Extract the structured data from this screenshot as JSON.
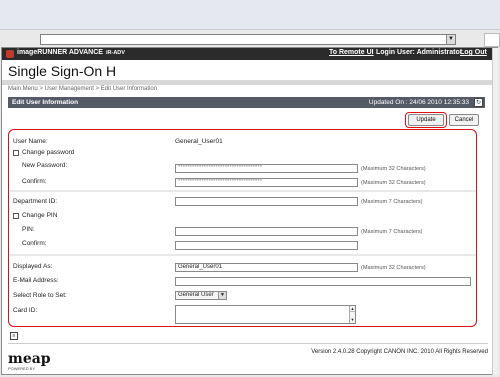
{
  "header": {
    "product": "imageRUNNER ADVANCE",
    "model": "iR-ADV",
    "link_remote_ui": "To Remote UI",
    "login_user": "Login User: Administrator",
    "logout": "Log Out"
  },
  "app_title": "Single Sign-On H",
  "breadcrumb": "Main Menu > User Management  > Edit User Information",
  "section": {
    "title": "Edit User Information",
    "updated": "Updated On : 24/06 2010 12:35:33"
  },
  "buttons": {
    "update": "Update",
    "cancel": "Cancel"
  },
  "form": {
    "user_name_label": "User Name:",
    "user_name_value": "General_User01",
    "change_password_label": "Change password",
    "new_password_label": "New Password:",
    "new_password_value": "************************************",
    "confirm_label": "Confirm:",
    "confirm_password_value": "************************************",
    "max32": "(Maximum 32 Characters)",
    "department_label": "Department ID:",
    "max7": "(Maximum 7 Characters)",
    "change_pin_label": "Change PIN",
    "pin_label": "PIN:",
    "pin_confirm_label": "Confirm:",
    "displayed_as_label": "Displayed As:",
    "displayed_as_value": "General_User01",
    "email_label": "E-Mail Address:",
    "role_label": "Select Role to Set:",
    "role_value": "General User",
    "card_id_label": "Card ID:"
  },
  "footer": {
    "logo": "meap",
    "logo_sub": "POWERED BY",
    "copyright": "Version 2.4.0.28 Copyright CANON INC. 2010 All Rights Reserved"
  }
}
